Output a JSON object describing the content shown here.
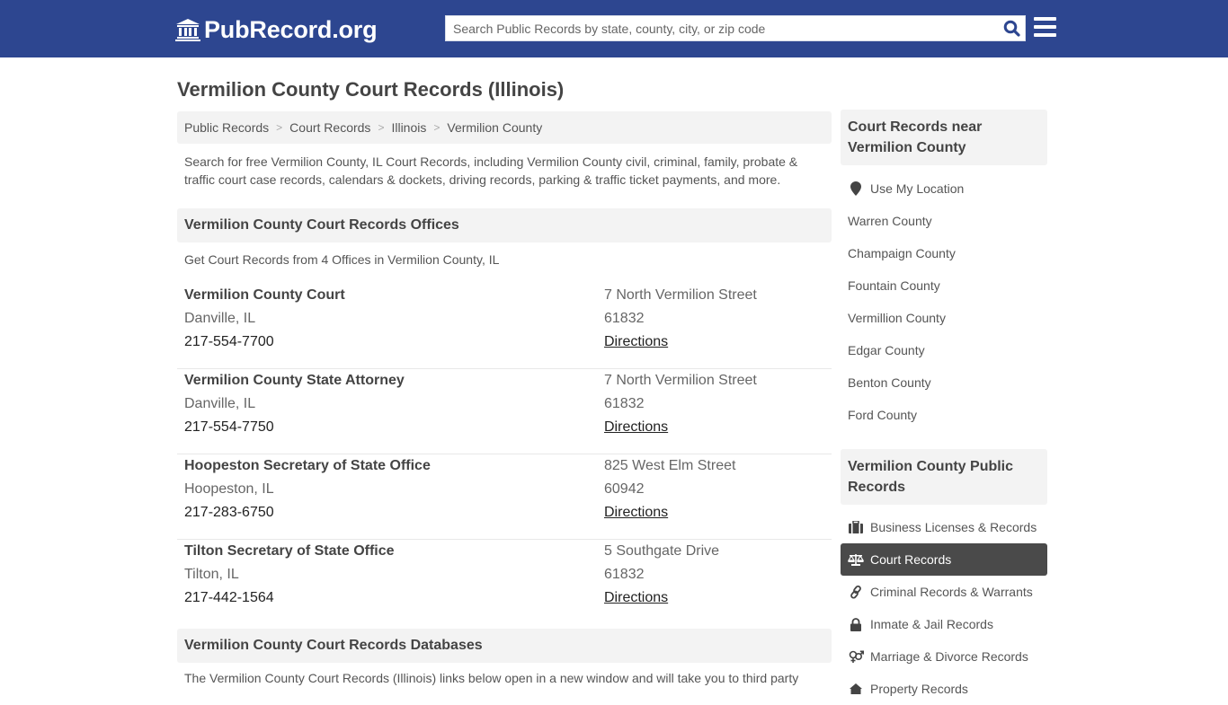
{
  "header": {
    "logo_text": "PubRecord.org",
    "search_placeholder": "Search Public Records by state, county, city, or zip code",
    "search_value": "",
    "brand_color": "#2d4690"
  },
  "page": {
    "title": "Vermilion County Court Records (Illinois)",
    "breadcrumb": [
      "Public Records",
      "Court Records",
      "Illinois",
      "Vermilion County"
    ],
    "intro": "Search for free Vermilion County, IL Court Records, including Vermilion County civil, criminal, family, probate & traffic court case records, calendars & dockets, driving records, parking & traffic ticket payments, and more."
  },
  "offices_section": {
    "heading": "Vermilion County Court Records Offices",
    "subtitle": "Get Court Records from 4 Offices in Vermilion County, IL",
    "offices": [
      {
        "name": "Vermilion County Court",
        "city": "Danville, IL",
        "phone": "217-554-7700",
        "address": "7 North Vermilion Street",
        "zip": "61832",
        "directions": "Directions"
      },
      {
        "name": "Vermilion County State Attorney",
        "city": "Danville, IL",
        "phone": "217-554-7750",
        "address": "7 North Vermilion Street",
        "zip": "61832",
        "directions": "Directions"
      },
      {
        "name": "Hoopeston Secretary of State Office",
        "city": "Hoopeston, IL",
        "phone": "217-283-6750",
        "address": "825 West Elm Street",
        "zip": "60942",
        "directions": "Directions"
      },
      {
        "name": "Tilton Secretary of State Office",
        "city": "Tilton, IL",
        "phone": "217-442-1564",
        "address": "5 Southgate Drive",
        "zip": "61832",
        "directions": "Directions"
      }
    ]
  },
  "databases_section": {
    "heading": "Vermilion County Court Records Databases",
    "text": "The Vermilion County Court Records (Illinois) links below open in a new window and will take you to third party"
  },
  "sidebar": {
    "nearby": {
      "heading": "Court Records near Vermilion County",
      "use_location": "Use My Location",
      "counties": [
        "Warren County",
        "Champaign County",
        "Fountain County",
        "Vermillion County",
        "Edgar County",
        "Benton County",
        "Ford County"
      ]
    },
    "public_records": {
      "heading": "Vermilion County Public Records",
      "items": [
        {
          "label": "Business Licenses & Records",
          "icon": "briefcase-icon"
        },
        {
          "label": "Court Records",
          "icon": "scale-icon",
          "active": true
        },
        {
          "label": "Criminal Records & Warrants",
          "icon": "link-icon"
        },
        {
          "label": "Inmate & Jail Records",
          "icon": "lock-icon"
        },
        {
          "label": "Marriage & Divorce Records",
          "icon": "gender-icon"
        },
        {
          "label": "Property Records",
          "icon": "home-icon"
        }
      ]
    }
  }
}
